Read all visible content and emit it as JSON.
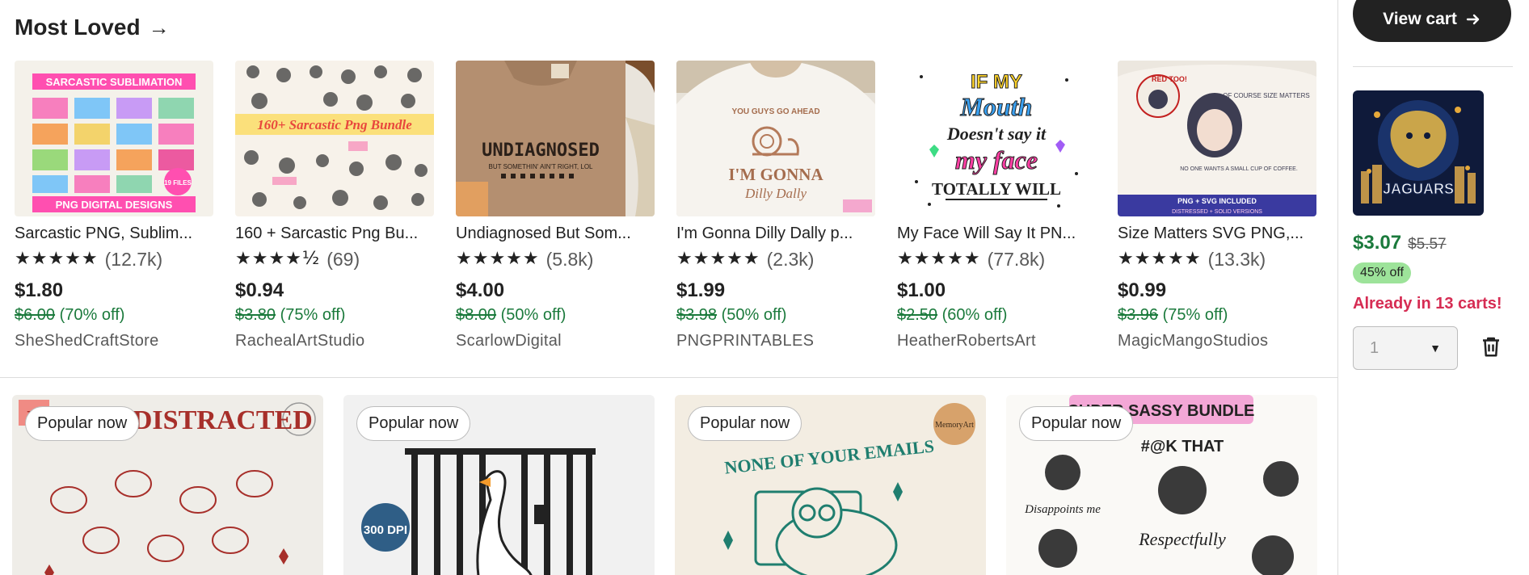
{
  "section": {
    "title": "Most Loved",
    "arrow": "→"
  },
  "products": [
    {
      "title": "Sarcastic PNG, Sublim...",
      "stars": "★★★★★",
      "reviews": "(12.7k)",
      "price": "$1.80",
      "original": "$6.00",
      "discount": "(70% off)",
      "shop": "SheShedCraftStore"
    },
    {
      "title": "160 + Sarcastic Png Bu...",
      "stars": "★★★★½",
      "reviews": "(69)",
      "price": "$0.94",
      "original": "$3.80",
      "discount": "(75% off)",
      "shop": "RachealArtStudio"
    },
    {
      "title": "Undiagnosed But Som...",
      "stars": "★★★★★",
      "reviews": "(5.8k)",
      "price": "$4.00",
      "original": "$8.00",
      "discount": "(50% off)",
      "shop": "ScarlowDigital"
    },
    {
      "title": "I'm Gonna Dilly Dally p...",
      "stars": "★★★★★",
      "reviews": "(2.3k)",
      "price": "$1.99",
      "original": "$3.98",
      "discount": "(50% off)",
      "shop": "PNGPRINTABLES"
    },
    {
      "title": "My Face Will Say It PN...",
      "stars": "★★★★★",
      "reviews": "(77.8k)",
      "price": "$1.00",
      "original": "$2.50",
      "discount": "(60% off)",
      "shop": "HeatherRobertsArt"
    },
    {
      "title": "Size Matters SVG PNG,...",
      "stars": "★★★★★",
      "reviews": "(13.3k)",
      "price": "$0.99",
      "original": "$3.96",
      "discount": "(75% off)",
      "shop": "MagicMangoStudios"
    }
  ],
  "product_images": [
    {
      "top_text": "SARCASTIC SUBLIMATION",
      "bottom_text": "PNG DIGITAL DESIGNS",
      "tag": "19 FILES"
    },
    {
      "banner": "160+ Sarcastic Png Bundle"
    },
    {
      "shirt_text": "UNDIAGNOSED",
      "shirt_sub": "BUT SOMETHIN' AIN'T RIGHT, LOL"
    },
    {
      "line1": "YOU GUYS GO AHEAD",
      "line2": "I'M GONNA",
      "line3": "Dilly Dally"
    },
    {
      "line1": "IF MY",
      "line2": "Mouth",
      "line3": "Doesn't say it",
      "line4": "my face",
      "line5": "TOTALLY WILL"
    },
    {
      "tag": "RED TOO!",
      "line1": "OF COURSE SIZE MATTERS",
      "line2": "NO ONE WANTS A SMALL CUP OF COFFEE.",
      "banner": "PNG + SVG INCLUDED",
      "banner_sub": "DISTRESSED + SOLID VERSIONS"
    }
  ],
  "popular": [
    {
      "badge": "Popular now",
      "art_text": "EASILY DISTRACTED"
    },
    {
      "badge": "Popular now",
      "dpi": "300 DPI"
    },
    {
      "badge": "Popular now",
      "art_text": "NONE OF YOUR EMAILS",
      "logo": "MemoryArt"
    },
    {
      "badge": "Popular now",
      "banner": "SUPER SASSY BUNDLE",
      "line1": "#@K THAT",
      "line2": "Respectfully",
      "line3": "Disappoints me"
    }
  ],
  "cart": {
    "button": "View cart",
    "thumb_text": "JAGUARS",
    "price": "$3.07",
    "original": "$5.57",
    "off": "45% off",
    "in_carts": "Already in 13 carts!",
    "quantity": "1"
  },
  "colors": {
    "sale_green": "#1b7a3c",
    "alert_red": "#d62c53",
    "badge_green": "#9de39a",
    "dark": "#222222"
  }
}
